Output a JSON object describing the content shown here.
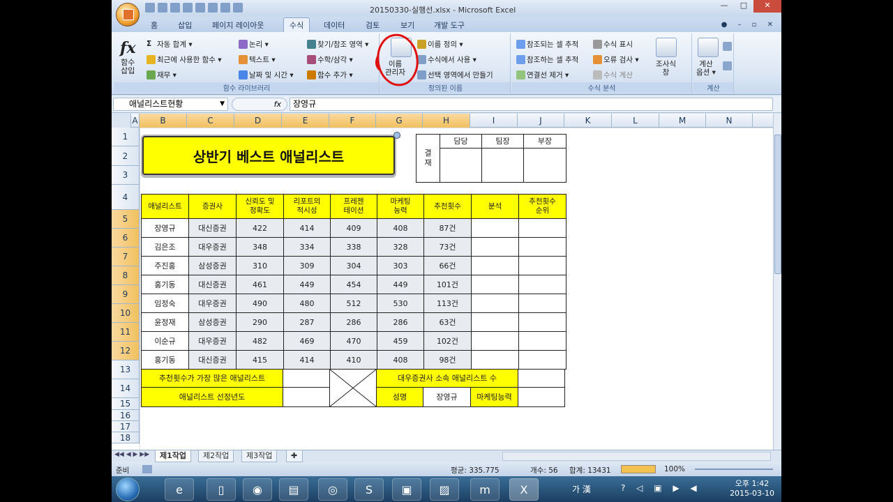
{
  "window": {
    "title": "20150330-실행선.xlsx - Microsoft Excel"
  },
  "ribbon_tabs": [
    "홈",
    "삽입",
    "페이지 레이아웃",
    "수식",
    "데이터",
    "검토",
    "보기",
    "개발 도구"
  ],
  "active_tab": "수식",
  "ribbon": {
    "insert_function": "함수\n삽입",
    "library": {
      "autosum": "자동 합계 ▾",
      "recent": "최근에 사용한 함수 ▾",
      "financial": "재무 ▾",
      "logical": "논리 ▾",
      "text": "텍스트 ▾",
      "datetime": "날짜 및 시간 ▾",
      "lookup": "찾기/참조 영역 ▾",
      "math": "수학/삼각 ▾",
      "more": "함수 추가 ▾",
      "group_label": "함수 라이브러리"
    },
    "names": {
      "manager": "이름\n관리자",
      "define": "이름 정의 ▾",
      "use_in_formula": "수식에서 사용 ▾",
      "create_from_selection": "선택 영역에서 만들기",
      "group_label": "정의된 이름"
    },
    "audit": {
      "trace_precedents": "참조되는 셀 추적",
      "trace_dependents": "참조하는 셀 추적",
      "remove_arrows": "연결선 제거 ▾",
      "show_formulas": "수식 표시",
      "error_check": "오류 검사 ▾",
      "evaluate": "수식 계산",
      "watch": "조사식\n창",
      "group_label": "수식 분석"
    },
    "calc": {
      "options": "계산\n옵션 ▾",
      "group_label": "계산"
    }
  },
  "formula_bar": {
    "name_box": "애널리스트현황",
    "fx": "fx",
    "formula": "장영규"
  },
  "columns": [
    "A",
    "B",
    "C",
    "D",
    "E",
    "F",
    "G",
    "H",
    "I",
    "J",
    "K",
    "L",
    "M",
    "N"
  ],
  "rows": [
    "1",
    "2",
    "3",
    "4",
    "5",
    "6",
    "7",
    "8",
    "9",
    "10",
    "11",
    "12",
    "13",
    "14",
    "15",
    "16",
    "17",
    "18"
  ],
  "sheet": {
    "banner": "상반기 베스트 애널리스트",
    "approval": {
      "label": "결\n재",
      "roles": [
        "담당",
        "팀장",
        "부장"
      ]
    },
    "headers": [
      "애널리스트",
      "증권사",
      "신뢰도 및\n정확도",
      "리포트의\n적시성",
      "프레젠\n테이션",
      "마케팅\n능력",
      "추천횟수",
      "분석",
      "추천횟수\n순위"
    ],
    "data_rows": [
      [
        "장영규",
        "대신증권",
        "422",
        "414",
        "409",
        "408",
        "87건",
        "",
        ""
      ],
      [
        "김은조",
        "대우증권",
        "348",
        "334",
        "338",
        "328",
        "73건",
        "",
        ""
      ],
      [
        "주진홍",
        "삼성증권",
        "310",
        "309",
        "304",
        "303",
        "66건",
        "",
        ""
      ],
      [
        "홍기동",
        "대신증권",
        "461",
        "449",
        "454",
        "449",
        "101건",
        "",
        ""
      ],
      [
        "임정숙",
        "대우증권",
        "490",
        "480",
        "512",
        "530",
        "113건",
        "",
        ""
      ],
      [
        "윤정재",
        "삼성증권",
        "290",
        "287",
        "286",
        "286",
        "63건",
        "",
        ""
      ],
      [
        "이순규",
        "대우증권",
        "482",
        "469",
        "470",
        "459",
        "102건",
        "",
        ""
      ],
      [
        "홍기동",
        "대신증권",
        "415",
        "414",
        "410",
        "408",
        "98건",
        "",
        ""
      ]
    ],
    "footer": {
      "most_recommended": "추천횟수가 가장 많은 애널리스트",
      "selection_year": "애널리스트 선정년도",
      "daewoo_count": "대우증권사 소속 애널리스트 수",
      "name_label": "성명",
      "name_value": "장영규",
      "marketing_label": "마케팅능력"
    }
  },
  "sheet_tabs": [
    "제1작업",
    "제2작업",
    "제3작업"
  ],
  "status": {
    "ready": "준비",
    "average": "평균: 335.775",
    "count": "개수: 56",
    "sum": "합계: 13431",
    "zoom": "100%"
  },
  "taskbar": {
    "ime": "가 漢",
    "time": "오후 1:42",
    "date": "2015-03-10"
  },
  "colors": {
    "header_yellow": "#ffff00",
    "annotation_red": "#e01010"
  }
}
